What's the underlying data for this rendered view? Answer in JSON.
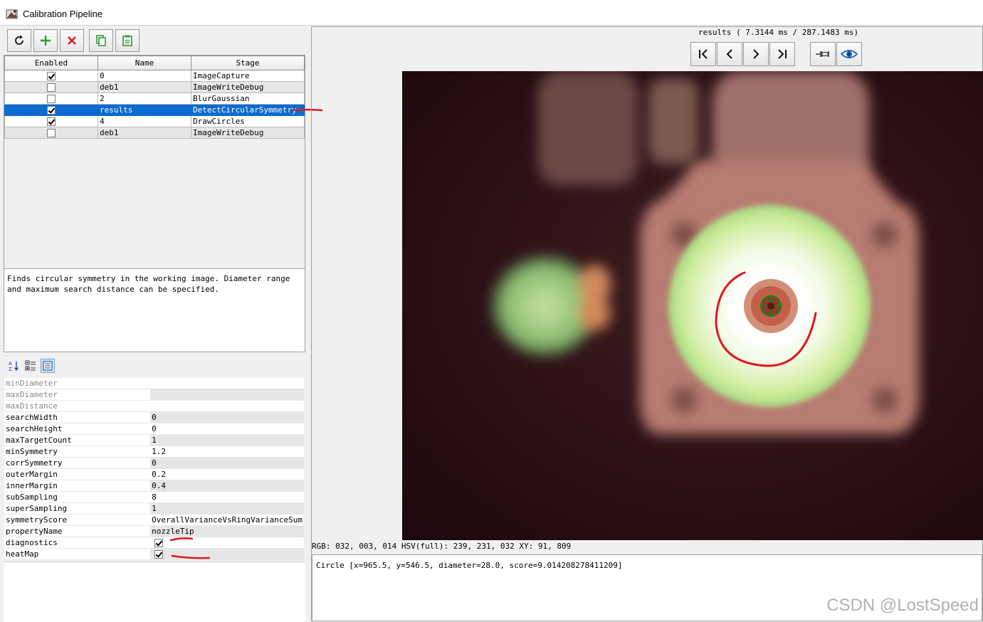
{
  "window": {
    "title": "Calibration Pipeline"
  },
  "toolbar": {
    "buttons": [
      {
        "icon": "refresh-icon"
      },
      {
        "icon": "add-icon",
        "color": "#2e9e2e"
      },
      {
        "icon": "delete-icon",
        "color": "#d01a1a"
      },
      {
        "icon": "copy-icon",
        "color": "#2e9e2e"
      },
      {
        "icon": "paste-icon",
        "color": "#2e9e2e"
      }
    ]
  },
  "stages": {
    "headers": [
      "Enabled",
      "Name",
      "Stage"
    ],
    "rows": [
      {
        "enabled": true,
        "name": "0",
        "stage": "ImageCapture"
      },
      {
        "enabled": false,
        "name": "deb1",
        "stage": "ImageWriteDebug"
      },
      {
        "enabled": false,
        "name": "2",
        "stage": "BlurGaussian"
      },
      {
        "enabled": true,
        "name": "results",
        "stage": "DetectCircularSymmetry",
        "selected": true
      },
      {
        "enabled": true,
        "name": "4",
        "stage": "DrawCircles"
      },
      {
        "enabled": false,
        "name": "deb1",
        "stage": "ImageWriteDebug"
      }
    ]
  },
  "description": "Finds circular symmetry in the working image. Diameter range and maximum search distance can be specified.",
  "properties": [
    {
      "key": "minDiameter",
      "value": "",
      "dim": true
    },
    {
      "key": "maxDiameter",
      "value": "",
      "dim": true
    },
    {
      "key": "maxDistance",
      "value": "",
      "dim": true
    },
    {
      "key": "searchWidth",
      "value": "0"
    },
    {
      "key": "searchHeight",
      "value": "0"
    },
    {
      "key": "maxTargetCount",
      "value": "1"
    },
    {
      "key": "minSymmetry",
      "value": "1.2"
    },
    {
      "key": "corrSymmetry",
      "value": "0"
    },
    {
      "key": "outerMargin",
      "value": "0.2"
    },
    {
      "key": "innerMargin",
      "value": "0.4"
    },
    {
      "key": "subSampling",
      "value": "8"
    },
    {
      "key": "superSampling",
      "value": "1"
    },
    {
      "key": "symmetryScore",
      "value": "OverallVarianceVsRingVarianceSum"
    },
    {
      "key": "propertyName",
      "value": "nozzleTip"
    },
    {
      "key": "diagnostics",
      "checkbox": true,
      "checked": true
    },
    {
      "key": "heatMap",
      "checkbox": true,
      "checked": true
    }
  ],
  "viewer": {
    "status": "results ( 7.3144 ms / 287.1483 ms)",
    "pixel_info": "RGB: 032, 003, 014 HSV(full): 239, 231, 032 XY: 91, 809",
    "result": "Circle [x=965.5, y=546.5, diameter=28.0, score=9.014208278411209]"
  },
  "nav": {
    "icons": [
      "first-icon",
      "prev-icon",
      "next-icon",
      "last-icon",
      "pin-icon",
      "eye-icon"
    ]
  },
  "colors": {
    "selection": "#0c6bd0",
    "annotation": "#e0161e"
  },
  "watermark": "CSDN @LostSpeed"
}
